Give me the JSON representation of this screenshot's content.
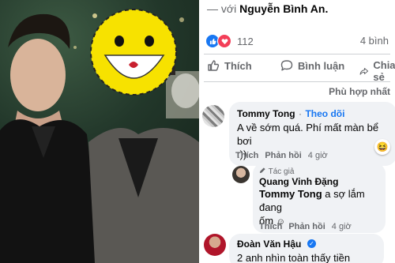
{
  "post": {
    "tag_prefix": "— với ",
    "tagged_name": "Nguyễn Bình An.",
    "reaction_count": "112",
    "share_count": "4 bình",
    "sort_label": "Phù hợp nhất"
  },
  "actions": {
    "like": "Thích",
    "comment": "Bình luận",
    "share": "Chia sẻ"
  },
  "comments": [
    {
      "author": "Tommy Tong",
      "follow_label": "Theo dõi",
      "text_line1": "A về sớm quá. Phí mất màn bể bơi",
      "text_line2": ":))",
      "like_label": "Thích",
      "reply_label": "Phản hồi",
      "time": "4 giờ",
      "reaction_emoji": "😆"
    },
    {
      "author_badge": "Tác giả",
      "author": "Quang Vinh Đặng",
      "mention": "Tommy Tong",
      "text_rest": " a sợ lắm đang",
      "text_line2": "ốm",
      "like_label": "Thích",
      "reply_label": "Phản hồi",
      "time": "4 giờ"
    },
    {
      "author": "Đoàn Văn Hậu",
      "text": "2 anh nhìn toàn thấy tiền"
    }
  ],
  "colors": {
    "facebook_blue": "#1877f2",
    "love_red": "#f33e58",
    "bubble_gray": "#f0f2f5",
    "meta_gray": "#65676b",
    "emoji_yellow": "#f7e200"
  }
}
